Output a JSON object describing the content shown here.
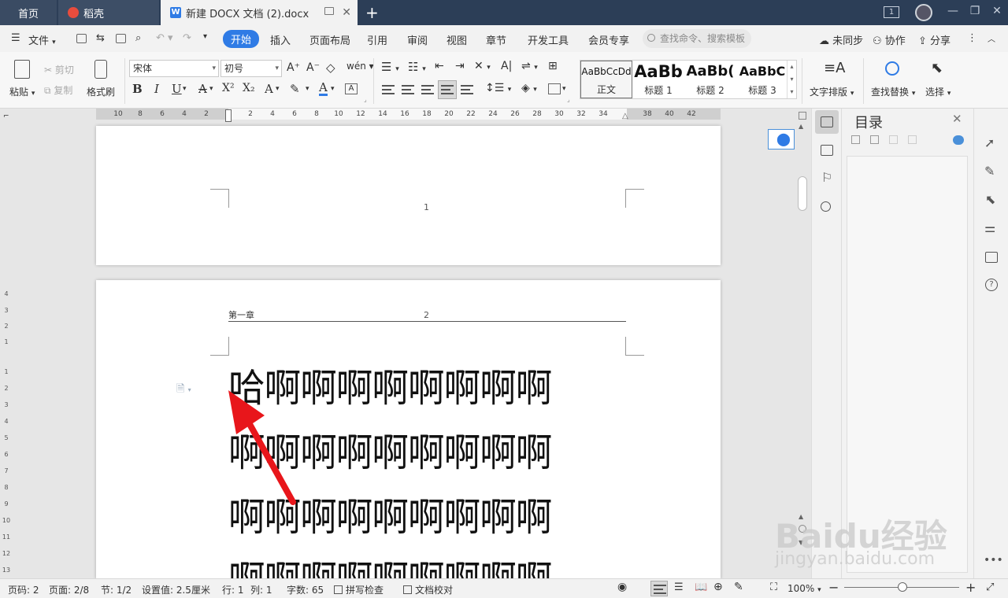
{
  "titlebar": {
    "tabs": [
      {
        "label": "首页"
      },
      {
        "label": "稻壳"
      },
      {
        "label": "新建 DOCX 文档 (2).docx",
        "icon": "W"
      }
    ],
    "window_number": "1"
  },
  "menubar": {
    "file_label": "文件",
    "items": [
      "开始",
      "插入",
      "页面布局",
      "引用",
      "审阅",
      "视图",
      "章节",
      "开发工具",
      "会员专享"
    ],
    "active_item": "开始",
    "search_placeholder": "查找命令、搜索模板",
    "sync_label": "未同步",
    "collab_label": "协作",
    "share_label": "分享"
  },
  "ribbon": {
    "paste_label": "粘贴",
    "cut_label": "剪切",
    "copy_label": "复制",
    "format_painter_label": "格式刷",
    "font_name": "宋体",
    "font_size": "初号",
    "styles": [
      {
        "preview": "AaBbCcDd",
        "name": "正文"
      },
      {
        "preview": "AaBb",
        "name": "标题 1"
      },
      {
        "preview": "AaBb(",
        "name": "标题 2"
      },
      {
        "preview": "AaBbC",
        "name": "标题 3"
      }
    ],
    "text_layout_label": "文字排版",
    "find_replace_label": "查找替换",
    "select_label": "选择",
    "bold": "B",
    "italic": "I",
    "underline": "U",
    "superscript": "X²",
    "subscript": "X₂",
    "font_color": "A"
  },
  "ruler": {
    "ticks": [
      "10",
      "8",
      "6",
      "4",
      "2",
      "2",
      "4",
      "6",
      "8",
      "10",
      "12",
      "14",
      "16",
      "18",
      "20",
      "22",
      "24",
      "26",
      "28",
      "30",
      "32",
      "34",
      "38",
      "40",
      "42"
    ],
    "vticks_top": [
      "4",
      "3",
      "2",
      "1"
    ],
    "vticks_bottom": [
      "1",
      "2",
      "3",
      "4",
      "5",
      "6",
      "7",
      "8",
      "9",
      "10",
      "11",
      "12",
      "13"
    ]
  },
  "document": {
    "page1_number": "1",
    "page2_header": "第一章",
    "page2_number": "2",
    "lines": [
      "哈啊啊啊啊啊啊啊啊",
      "啊啊啊啊啊啊啊啊啊",
      "啊啊啊啊啊啊啊啊啊",
      "啊啊啊啊啊啊啊啊啊"
    ]
  },
  "navpane": {
    "title": "目录"
  },
  "statusbar": {
    "page_code": "页码: 2",
    "page": "页面: 2/8",
    "section": "节: 1/2",
    "setting": "设置值: 2.5厘米",
    "row": "行: 1",
    "col": "列: 1",
    "word_count": "字数: 65",
    "spell_check": "拼写检查",
    "doc_proof": "文档校对",
    "zoom": "100%"
  },
  "watermark": {
    "brand": "Baidu经验",
    "url": "jingyan.baidu.com"
  },
  "colors": {
    "accent": "#2f7be5",
    "titlebar": "#2c3e57",
    "arrow": "#e8161b"
  }
}
